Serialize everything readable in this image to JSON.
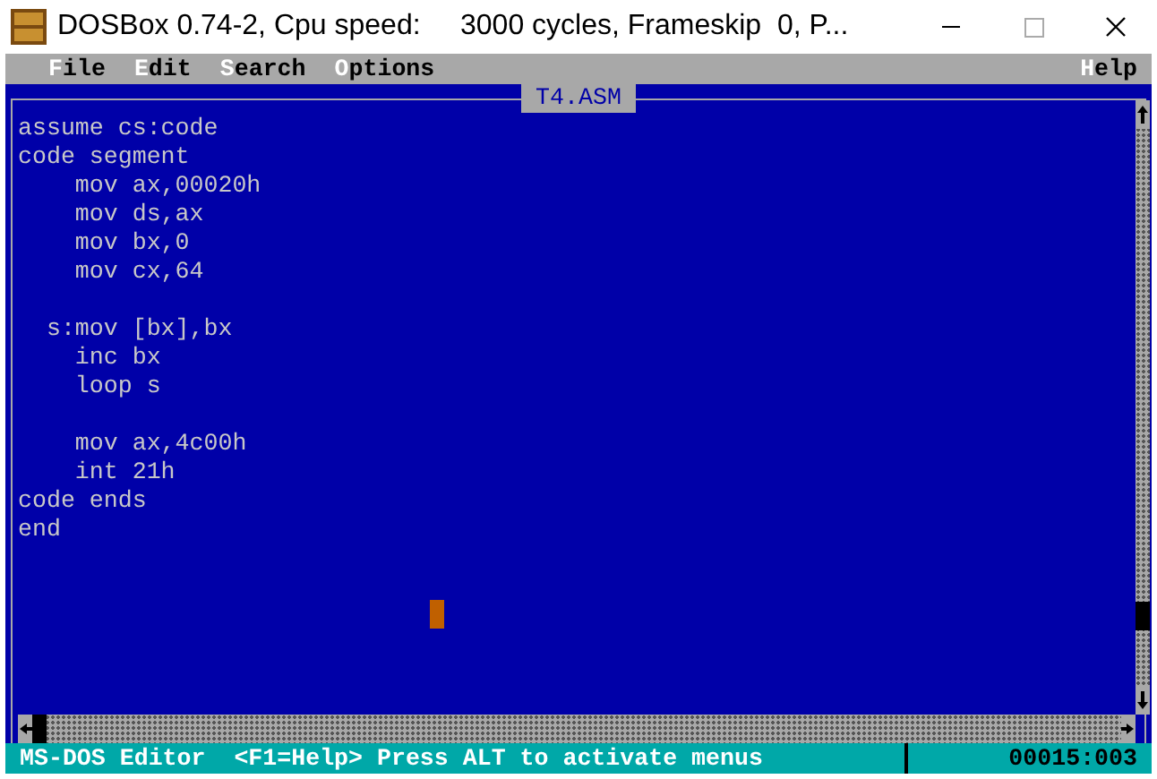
{
  "window": {
    "title": "DOSBox 0.74-2, Cpu speed:     3000 cycles, Frameskip  0, P..."
  },
  "menu": [
    {
      "hotkey": "F",
      "rest": "ile"
    },
    {
      "hotkey": "E",
      "rest": "dit"
    },
    {
      "hotkey": "S",
      "rest": "earch"
    },
    {
      "hotkey": "O",
      "rest": "ptions"
    },
    {
      "hotkey": "H",
      "rest": "elp"
    }
  ],
  "editor": {
    "title": "T4.ASM",
    "code_blocks": [
      [
        "assume cs:code",
        "code segment",
        "    mov ax,00020h",
        "    mov ds,ax",
        "    mov bx,0",
        "    mov cx,64"
      ],
      [
        "  s:mov [bx],bx",
        "    inc bx",
        "    loop s"
      ],
      [
        "    mov ax,4c00h",
        "    int 21h",
        "code ends",
        "end"
      ]
    ]
  },
  "status_bar": {
    "message": "MS-DOS Editor  <F1=Help> Press ALT to activate menus",
    "position": "00015:003"
  }
}
